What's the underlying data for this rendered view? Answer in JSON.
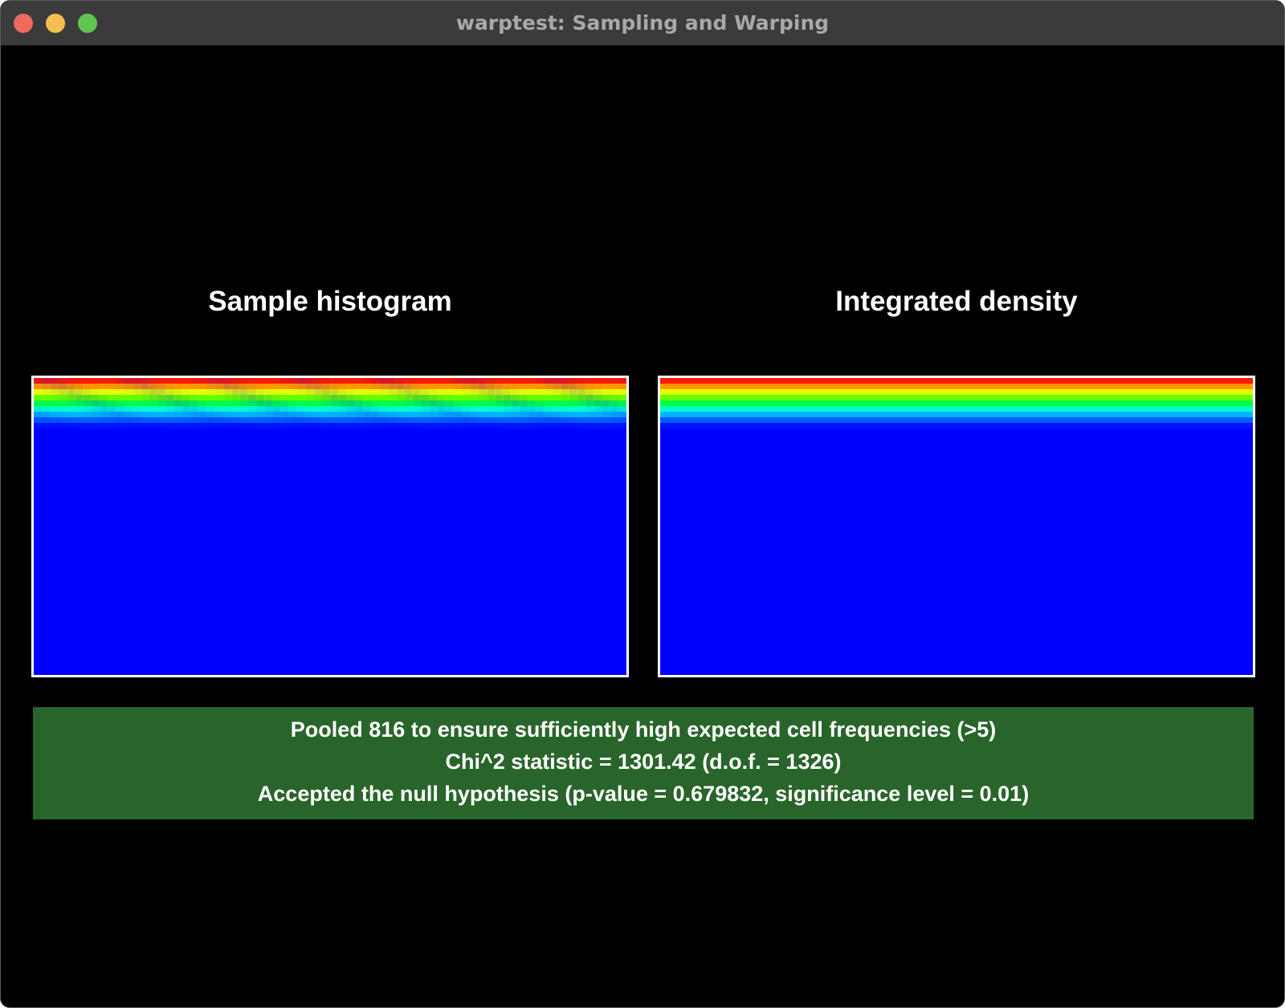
{
  "window": {
    "title": "warptest: Sampling and Warping"
  },
  "panels": {
    "left_title": "Sample histogram",
    "right_title": "Integrated density"
  },
  "colormap": {
    "top_bands": [
      "#ff1a00",
      "#ff9900",
      "#e6ff00",
      "#66ff00",
      "#00ff44",
      "#00ffcc",
      "#00b3ff",
      "#005cff",
      "#0014ff"
    ],
    "background": "#0000ff"
  },
  "result": {
    "status": "accepted",
    "color": "#29652a",
    "line1": "Pooled 816 to ensure sufficiently high expected cell frequencies (>5)",
    "line2": "Chi^2 statistic = 1301.42 (d.o.f. = 1326)",
    "line3": "Accepted the null hypothesis (p-value = 0.679832, significance level = 0.01)"
  }
}
